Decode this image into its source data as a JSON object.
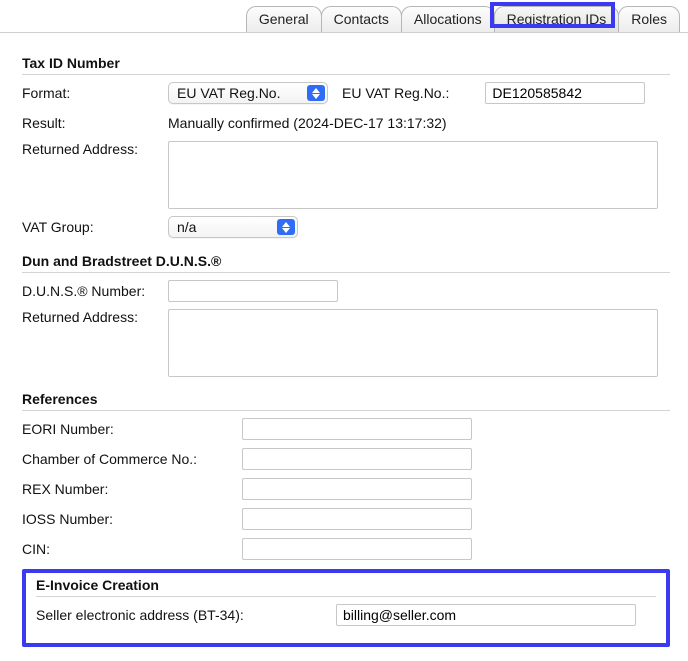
{
  "tabs": {
    "general": "General",
    "contacts": "Contacts",
    "allocations": "Allocations",
    "registration_ids": "Registration IDs",
    "roles": "Roles"
  },
  "tax": {
    "section_title": "Tax ID Number",
    "format_label": "Format:",
    "format_value": "EU VAT Reg.No.",
    "reg_label": "EU VAT Reg.No.:",
    "reg_value": "DE120585842",
    "result_label": "Result:",
    "result_value": "Manually confirmed (2024-DEC-17 13:17:32)",
    "returned_addr_label": "Returned Address:",
    "returned_addr_value": "",
    "vat_group_label": "VAT Group:",
    "vat_group_value": "n/a"
  },
  "duns": {
    "section_title": "Dun and Bradstreet D.U.N.S.®",
    "number_label": "D.U.N.S.® Number:",
    "number_value": "",
    "returned_addr_label": "Returned Address:",
    "returned_addr_value": ""
  },
  "refs": {
    "section_title": "References",
    "eori_label": "EORI Number:",
    "eori_value": "",
    "chamber_label": "Chamber of Commerce No.:",
    "chamber_value": "",
    "rex_label": "REX Number:",
    "rex_value": "",
    "ioss_label": "IOSS Number:",
    "ioss_value": "",
    "cin_label": "CIN:",
    "cin_value": ""
  },
  "einvoice": {
    "section_title": "E-Invoice Creation",
    "seller_addr_label": "Seller electronic address (BT-34):",
    "seller_addr_value": "billing@seller.com"
  }
}
